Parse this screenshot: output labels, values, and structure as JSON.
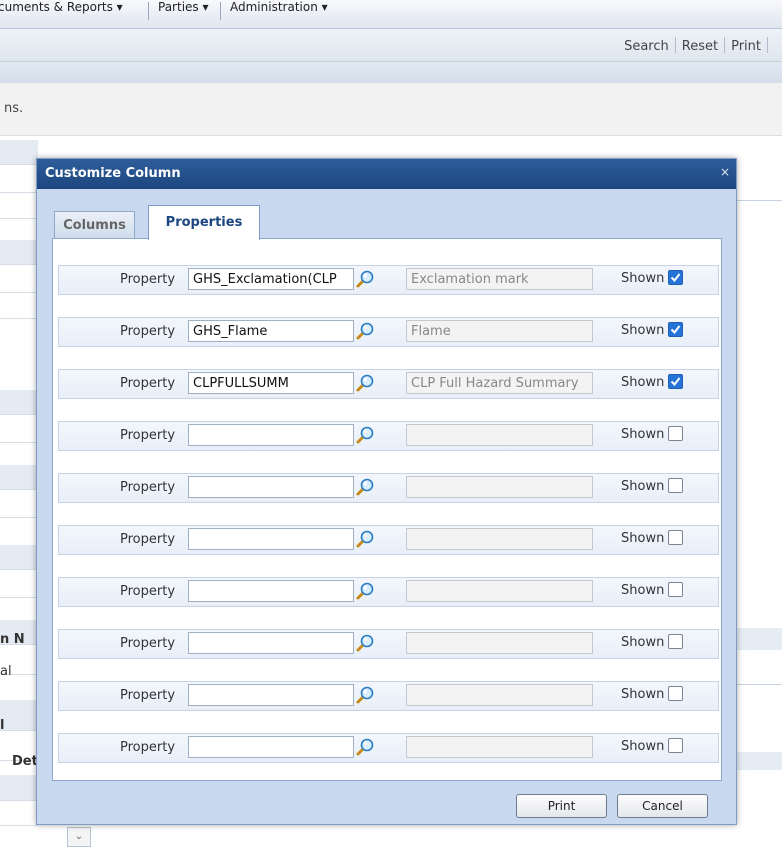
{
  "menubar": {
    "items": [
      "cuments & Reports",
      "Parties",
      "Administration"
    ]
  },
  "toolbar": {
    "search": "Search",
    "reset": "Reset",
    "print": "Print"
  },
  "background": {
    "info_text": "ns.",
    "fragment_1": "n N",
    "fragment_2": "al",
    "fragment_3": "l",
    "fragment_4": "Det"
  },
  "dialog": {
    "title": "Customize Column",
    "close_glyph": "×",
    "tabs": [
      {
        "label": "Columns",
        "active": false
      },
      {
        "label": "Properties",
        "active": true
      }
    ],
    "property_label": "Property",
    "shown_label": "Shown",
    "rows": [
      {
        "value": "GHS_Exclamation(CLP",
        "description": "Exclamation mark",
        "shown": true
      },
      {
        "value": "GHS_Flame",
        "description": "Flame",
        "shown": true
      },
      {
        "value": "CLPFULLSUMM",
        "description": "CLP Full Hazard Summary",
        "shown": true
      },
      {
        "value": "",
        "description": "",
        "shown": false
      },
      {
        "value": "",
        "description": "",
        "shown": false
      },
      {
        "value": "",
        "description": "",
        "shown": false
      },
      {
        "value": "",
        "description": "",
        "shown": false
      },
      {
        "value": "",
        "description": "",
        "shown": false
      },
      {
        "value": "",
        "description": "",
        "shown": false
      },
      {
        "value": "",
        "description": "",
        "shown": false
      }
    ],
    "buttons": {
      "print": "Print",
      "cancel": "Cancel"
    }
  },
  "colors": {
    "header": "#1c467f",
    "checkbox_on": "#2673d8",
    "dialog_frame": "#c7d8ef"
  }
}
